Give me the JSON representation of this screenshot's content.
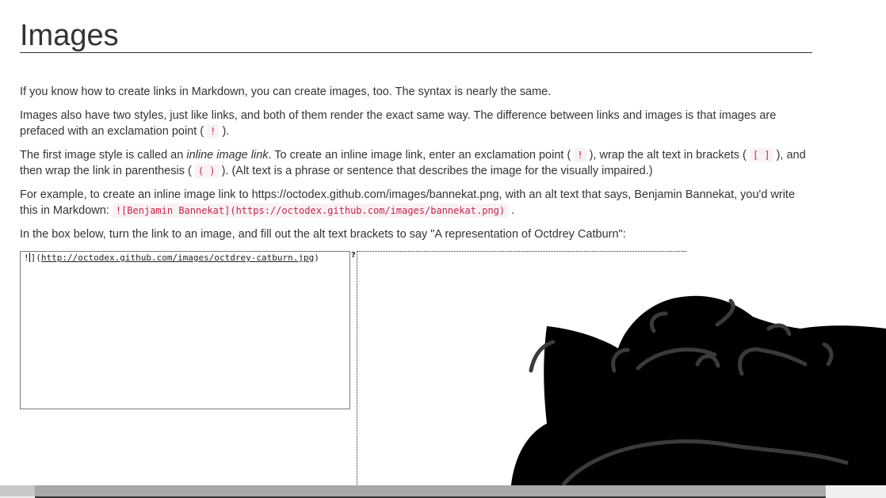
{
  "page": {
    "title": "Images"
  },
  "paragraphs": {
    "p1": "If you know how to create links in Markdown, you can create images, too. The syntax is nearly the same.",
    "p2_a": "Images also have two styles, just like links, and both of them render the exact same way. The difference between links and images is that images are prefaced with an exclamation point (",
    "p2_code": "!",
    "p2_b": ").",
    "p3_a": "The first image style is called an ",
    "p3_em": "inline image link",
    "p3_b": ". To create an inline image link, enter an exclamation point (",
    "p3_code1": "!",
    "p3_c": "), wrap the alt text in brackets (",
    "p3_code2": "[ ]",
    "p3_d": "), and then wrap the link in parenthesis (",
    "p3_code3": "( )",
    "p3_e": "). (Alt text is a phrase or sentence that describes the image for the visually impaired.)",
    "p4_a": "For example, to create an inline image link to https://octodex.github.com/images/bannekat.png, with an alt text that says, Benjamin Bannekat, you'd write this in Markdown: ",
    "p4_code": "![Benjamin Bannekat](https://octodex.github.com/images/bannekat.png)",
    "p4_b": ".",
    "p5": "In the box below, turn the link to an image, and fill out the alt text brackets to say \"A representation of Octdrey Catburn\":"
  },
  "editor": {
    "prefix": "!",
    "bracket_tail": "](",
    "url": "http://octodex.github.com/images/octdrey-catburn.jpg",
    "suffix": ")"
  },
  "preview": {
    "broken_image_glyph": "?"
  },
  "colors": {
    "code_text": "#c7254e",
    "code_bg": "#f9f2f4",
    "text": "#333333"
  }
}
